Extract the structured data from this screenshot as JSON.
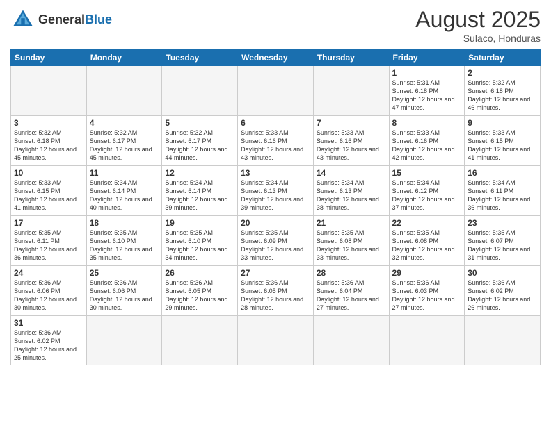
{
  "header": {
    "logo_general": "General",
    "logo_blue": "Blue",
    "month_title": "August 2025",
    "location": "Sulaco, Honduras"
  },
  "weekdays": [
    "Sunday",
    "Monday",
    "Tuesday",
    "Wednesday",
    "Thursday",
    "Friday",
    "Saturday"
  ],
  "weeks": [
    [
      {
        "day": "",
        "info": "",
        "empty": true
      },
      {
        "day": "",
        "info": "",
        "empty": true
      },
      {
        "day": "",
        "info": "",
        "empty": true
      },
      {
        "day": "",
        "info": "",
        "empty": true
      },
      {
        "day": "",
        "info": "",
        "empty": true
      },
      {
        "day": "1",
        "info": "Sunrise: 5:31 AM\nSunset: 6:18 PM\nDaylight: 12 hours\nand 47 minutes."
      },
      {
        "day": "2",
        "info": "Sunrise: 5:32 AM\nSunset: 6:18 PM\nDaylight: 12 hours\nand 46 minutes."
      }
    ],
    [
      {
        "day": "3",
        "info": "Sunrise: 5:32 AM\nSunset: 6:18 PM\nDaylight: 12 hours\nand 45 minutes."
      },
      {
        "day": "4",
        "info": "Sunrise: 5:32 AM\nSunset: 6:17 PM\nDaylight: 12 hours\nand 45 minutes."
      },
      {
        "day": "5",
        "info": "Sunrise: 5:32 AM\nSunset: 6:17 PM\nDaylight: 12 hours\nand 44 minutes."
      },
      {
        "day": "6",
        "info": "Sunrise: 5:33 AM\nSunset: 6:16 PM\nDaylight: 12 hours\nand 43 minutes."
      },
      {
        "day": "7",
        "info": "Sunrise: 5:33 AM\nSunset: 6:16 PM\nDaylight: 12 hours\nand 43 minutes."
      },
      {
        "day": "8",
        "info": "Sunrise: 5:33 AM\nSunset: 6:16 PM\nDaylight: 12 hours\nand 42 minutes."
      },
      {
        "day": "9",
        "info": "Sunrise: 5:33 AM\nSunset: 6:15 PM\nDaylight: 12 hours\nand 41 minutes."
      }
    ],
    [
      {
        "day": "10",
        "info": "Sunrise: 5:33 AM\nSunset: 6:15 PM\nDaylight: 12 hours\nand 41 minutes."
      },
      {
        "day": "11",
        "info": "Sunrise: 5:34 AM\nSunset: 6:14 PM\nDaylight: 12 hours\nand 40 minutes."
      },
      {
        "day": "12",
        "info": "Sunrise: 5:34 AM\nSunset: 6:14 PM\nDaylight: 12 hours\nand 39 minutes."
      },
      {
        "day": "13",
        "info": "Sunrise: 5:34 AM\nSunset: 6:13 PM\nDaylight: 12 hours\nand 39 minutes."
      },
      {
        "day": "14",
        "info": "Sunrise: 5:34 AM\nSunset: 6:13 PM\nDaylight: 12 hours\nand 38 minutes."
      },
      {
        "day": "15",
        "info": "Sunrise: 5:34 AM\nSunset: 6:12 PM\nDaylight: 12 hours\nand 37 minutes."
      },
      {
        "day": "16",
        "info": "Sunrise: 5:34 AM\nSunset: 6:11 PM\nDaylight: 12 hours\nand 36 minutes."
      }
    ],
    [
      {
        "day": "17",
        "info": "Sunrise: 5:35 AM\nSunset: 6:11 PM\nDaylight: 12 hours\nand 36 minutes."
      },
      {
        "day": "18",
        "info": "Sunrise: 5:35 AM\nSunset: 6:10 PM\nDaylight: 12 hours\nand 35 minutes."
      },
      {
        "day": "19",
        "info": "Sunrise: 5:35 AM\nSunset: 6:10 PM\nDaylight: 12 hours\nand 34 minutes."
      },
      {
        "day": "20",
        "info": "Sunrise: 5:35 AM\nSunset: 6:09 PM\nDaylight: 12 hours\nand 33 minutes."
      },
      {
        "day": "21",
        "info": "Sunrise: 5:35 AM\nSunset: 6:08 PM\nDaylight: 12 hours\nand 33 minutes."
      },
      {
        "day": "22",
        "info": "Sunrise: 5:35 AM\nSunset: 6:08 PM\nDaylight: 12 hours\nand 32 minutes."
      },
      {
        "day": "23",
        "info": "Sunrise: 5:35 AM\nSunset: 6:07 PM\nDaylight: 12 hours\nand 31 minutes."
      }
    ],
    [
      {
        "day": "24",
        "info": "Sunrise: 5:36 AM\nSunset: 6:06 PM\nDaylight: 12 hours\nand 30 minutes."
      },
      {
        "day": "25",
        "info": "Sunrise: 5:36 AM\nSunset: 6:06 PM\nDaylight: 12 hours\nand 30 minutes."
      },
      {
        "day": "26",
        "info": "Sunrise: 5:36 AM\nSunset: 6:05 PM\nDaylight: 12 hours\nand 29 minutes."
      },
      {
        "day": "27",
        "info": "Sunrise: 5:36 AM\nSunset: 6:05 PM\nDaylight: 12 hours\nand 28 minutes."
      },
      {
        "day": "28",
        "info": "Sunrise: 5:36 AM\nSunset: 6:04 PM\nDaylight: 12 hours\nand 27 minutes."
      },
      {
        "day": "29",
        "info": "Sunrise: 5:36 AM\nSunset: 6:03 PM\nDaylight: 12 hours\nand 27 minutes."
      },
      {
        "day": "30",
        "info": "Sunrise: 5:36 AM\nSunset: 6:02 PM\nDaylight: 12 hours\nand 26 minutes."
      }
    ],
    [
      {
        "day": "31",
        "info": "Sunrise: 5:36 AM\nSunset: 6:02 PM\nDaylight: 12 hours\nand 25 minutes."
      },
      {
        "day": "",
        "info": "",
        "empty": true
      },
      {
        "day": "",
        "info": "",
        "empty": true
      },
      {
        "day": "",
        "info": "",
        "empty": true
      },
      {
        "day": "",
        "info": "",
        "empty": true
      },
      {
        "day": "",
        "info": "",
        "empty": true
      },
      {
        "day": "",
        "info": "",
        "empty": true
      }
    ]
  ]
}
